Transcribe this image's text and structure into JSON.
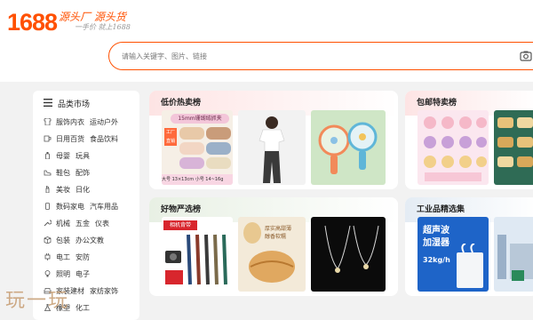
{
  "header": {
    "logo": "1688",
    "slogan_main": "源头厂 源头货",
    "slogan_sub": "一手价 就上1688"
  },
  "search": {
    "placeholder": "请输入关键字、图片、链接"
  },
  "sidebar": {
    "title": "品类市场",
    "categories": [
      [
        "服饰内衣",
        "运动户外"
      ],
      [
        "日用百货",
        "食品饮料"
      ],
      [
        "母婴",
        "玩具"
      ],
      [
        "鞋包",
        "配饰"
      ],
      [
        "美妆",
        "日化"
      ],
      [
        "数码家电",
        "汽车用品"
      ],
      [
        "机械",
        "五金",
        "仪表"
      ],
      [
        "包装",
        "办公文教"
      ],
      [
        "电工",
        "安防"
      ],
      [
        "照明",
        "电子"
      ],
      [
        "家装建材",
        "家纺家饰"
      ],
      [
        "橡塑",
        "化工"
      ]
    ]
  },
  "sections": [
    {
      "title": "低价热卖榜"
    },
    {
      "title": "包邮特卖榜"
    },
    {
      "title": "好物严选榜"
    },
    {
      "title": "工业品精选集"
    }
  ],
  "thumbs": {
    "clip_label": "15mm珊瑚绒抓夹",
    "clip_tag": "工厂直销",
    "clip_size1": "大号 13×13cm",
    "clip_size2": "小号 14~16g",
    "camera_label": "相机背带",
    "bread_label": "厚实高甜薄",
    "bread_label2": "醇香软糯",
    "humid_title": "超声波",
    "humid_title2": "加湿器",
    "humid_cap": "32kg/h"
  },
  "watermark": "玩一玩",
  "colors": {
    "brand": "#ff5000"
  }
}
